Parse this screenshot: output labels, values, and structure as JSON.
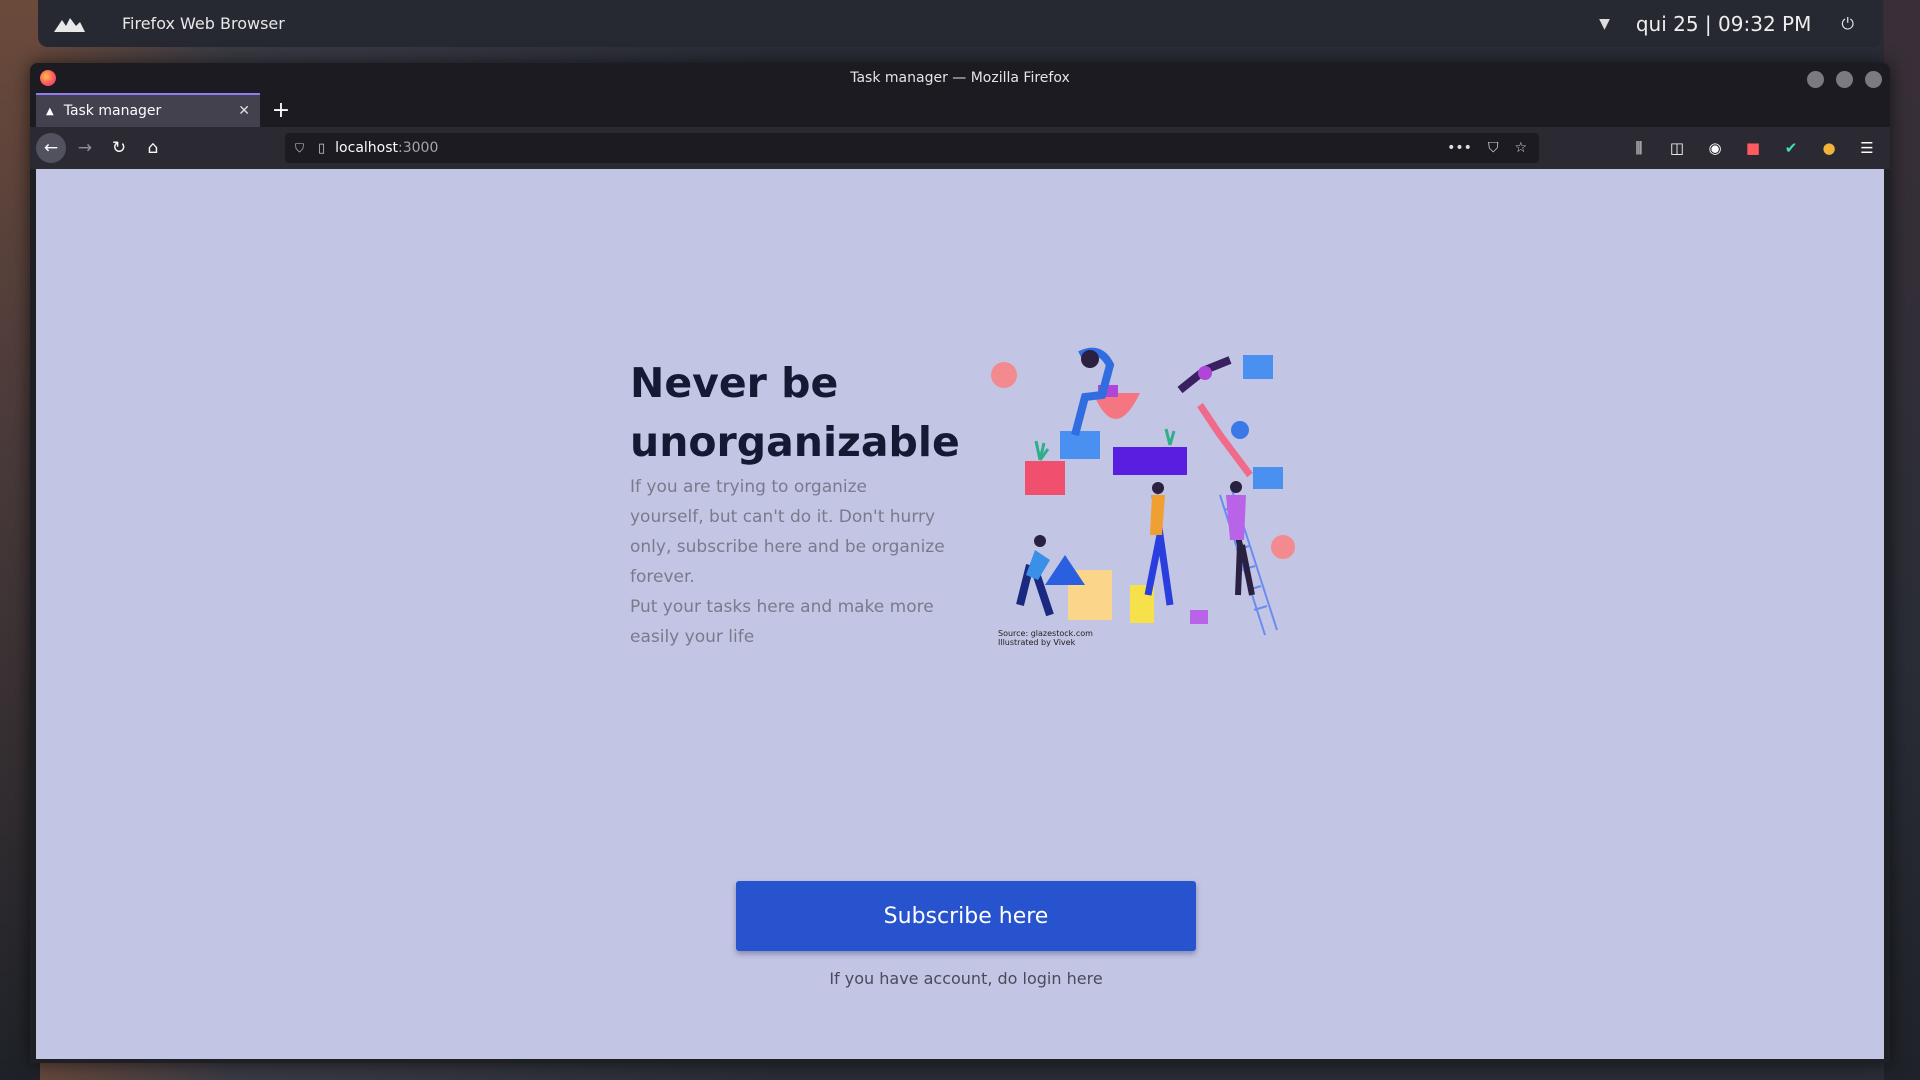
{
  "desktop": {
    "app_name": "Firefox Web Browser",
    "clock": "qui 25 | 09:32 PM"
  },
  "window": {
    "title": "Task manager — Mozilla Firefox"
  },
  "tab": {
    "label": "Task manager",
    "close": "✕",
    "new_tab": "+"
  },
  "navbar": {
    "url_host": "localhost",
    "url_port": ":3000",
    "actions": [
      "more-icon",
      "pocket-icon",
      "bookmark-star-icon"
    ],
    "toolbar_icons": [
      "library-icon",
      "sidebar-icon",
      "account-icon",
      "extension-red-icon",
      "extension-check-icon",
      "extension-owl-icon",
      "menu-icon"
    ]
  },
  "page": {
    "title_line1": "Never be",
    "title_line2": "unorganizable",
    "desc_line1": "If you are trying to organize",
    "desc_line2": "yourself, but can't do it. Don't hurry",
    "desc_line3": "only, subscribe here and be organize",
    "desc_line4": "forever.",
    "desc_line5": "Put your tasks here and make more",
    "desc_line6": "easily your life",
    "credit_line1": "Source: glazestock.com",
    "credit_line2": "Illustrated by Vivek",
    "subscribe_label": "Subscribe here",
    "login_text": "If you have account, do login here"
  },
  "colors": {
    "page_bg": "#c3c5e4",
    "button": "#2753cf",
    "title": "#151a34",
    "desc": "#7a7a8e"
  }
}
